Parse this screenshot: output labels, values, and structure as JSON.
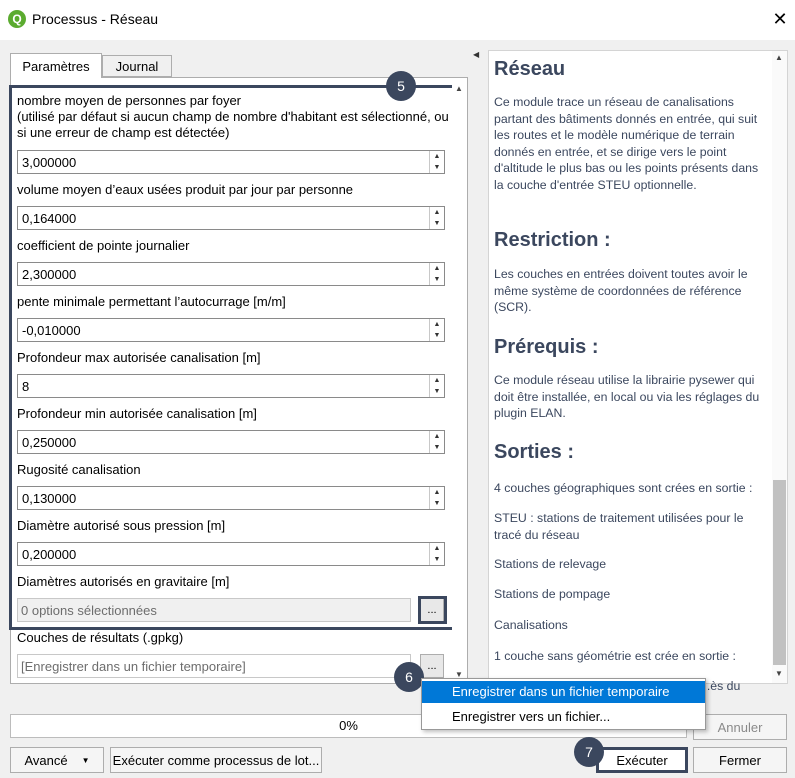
{
  "window": {
    "title": "Processus - Réseau",
    "close": "✕",
    "logo": "Q"
  },
  "tabs": {
    "params": "Paramètres",
    "journal": "Journal"
  },
  "params": [
    {
      "label": "nombre moyen de personnes par foyer\n(utilisé par défaut si aucun champ de nombre d'habitant est sélectionné, ou\nsi une erreur de champ est détectée)",
      "value": "3,000000"
    },
    {
      "label": "volume moyen d’eaux usées produit par jour par personne",
      "value": "0,164000"
    },
    {
      "label": "coefficient de pointe journalier",
      "value": "2,300000"
    },
    {
      "label": "pente minimale permettant l’autocurrage [m/m]",
      "value": "-0,010000"
    },
    {
      "label": "Profondeur max autorisée canalisation [m]",
      "value": "8"
    },
    {
      "label": "Profondeur min autorisée canalisation [m]",
      "value": "0,250000"
    },
    {
      "label": "Rugosité canalisation",
      "value": "0,130000"
    },
    {
      "label": "Diamètre autorisé sous pression [m]",
      "value": "0,200000"
    }
  ],
  "gravity": {
    "label": "Diamètres autorisés en gravitaire [m]",
    "value": "0 options sélectionnées",
    "button": "..."
  },
  "output": {
    "label": "Couches de résultats (.gpkg)",
    "value": "[Enregistrer dans un fichier temporaire]",
    "button": "..."
  },
  "menu": {
    "items": [
      "Enregistrer dans un fichier temporaire",
      "Enregistrer vers un fichier..."
    ]
  },
  "badges": {
    "b5": "5",
    "b6": "6",
    "b7": "7"
  },
  "help": {
    "h1": "Réseau",
    "p1": "Ce module trace un réseau de canalisations partant des bâtiments donnés en entrée, qui suit les routes et le modèle numérique de terrain donnés en entrée, et se dirige vers le point d'altitude le plus bas ou les points présents dans la couche d'entrée STEU optionnelle.",
    "h2": "Restriction :",
    "p2": "Les couches en entrées doivent toutes avoir le même système de coordonnées de référence (SCR).",
    "h3": "Prérequis :",
    "p3": "Ce module réseau utilise la librairie pysewer qui doit être installée, en local ou via les réglages du plugin ELAN.",
    "h4": "Sorties :",
    "p4": "4 couches géographiques sont crées en sortie :",
    "p5": "STEU : stations de traitement utilisées pour le tracé du réseau",
    "p6": "Stations de relevage",
    "p7": "Stations de pompage",
    "p8": "Canalisations",
    "p9": "1 couche sans géométrie est crée en sortie :",
    "p10": "...ès du"
  },
  "progress": {
    "text": "0%",
    "value": 0
  },
  "buttons": {
    "cancel": "Annuler",
    "advanced": "Avancé",
    "batch": "Exécuter comme processus de lot...",
    "run": "Exécuter",
    "close": "Fermer"
  },
  "colors": {
    "accent": "#3b475e",
    "highlight": "#0078d7",
    "logo": "#5bab2f"
  }
}
